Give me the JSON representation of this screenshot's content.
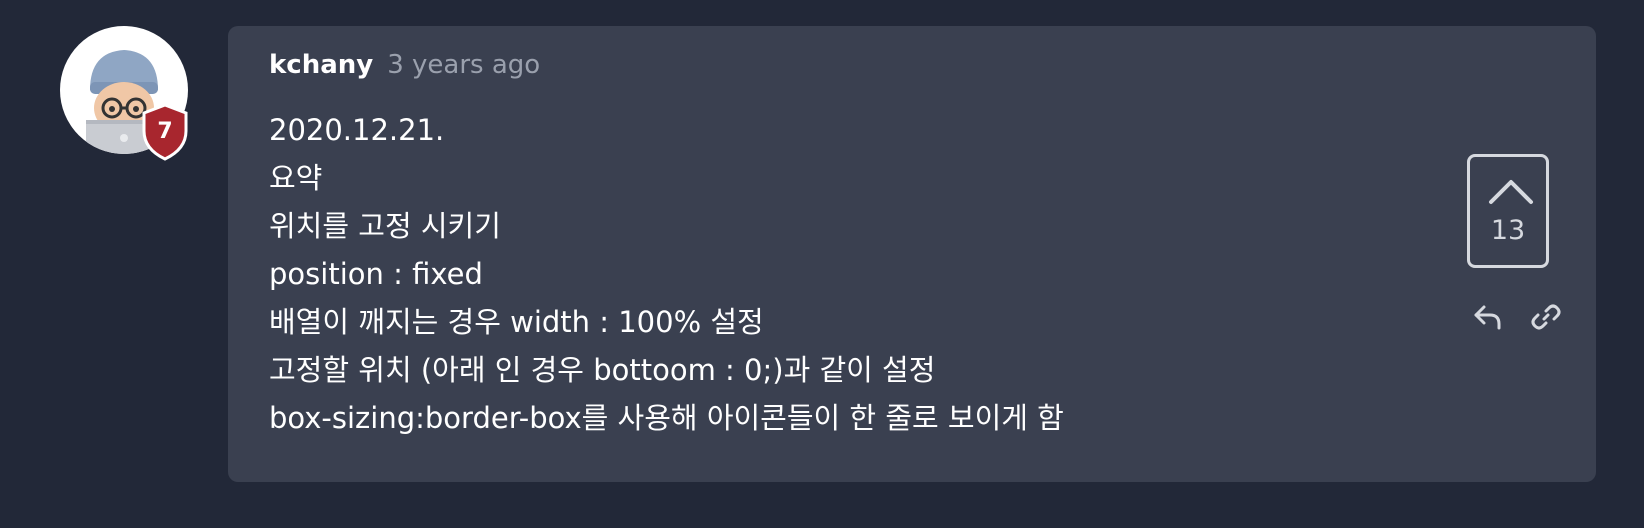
{
  "user": {
    "name": "kchany",
    "time_ago": "3 years ago",
    "badge_level": "7"
  },
  "comment": {
    "lines": [
      "2020.12.21.",
      "요약",
      "위치를 고정 시키기",
      "position : fixed",
      "배열이 깨지는 경우 width : 100% 설정",
      "고정할 위치 (아래 인 경우 bottoom : 0;)과 같이 설정",
      "box-sizing:border-box를 사용해 아이콘들이 한 줄로 보이게 함"
    ]
  },
  "vote": {
    "count": "13"
  },
  "icons": {
    "upvote": "chevron-up-icon",
    "reply": "reply-icon",
    "link": "link-icon",
    "avatar": "memoji-avatar",
    "badge": "shield-badge-icon"
  },
  "colors": {
    "page_bg": "#222838",
    "card_bg": "#3a4050",
    "text": "#ffffff",
    "muted": "#9aa0ad",
    "badge": "#a8262e"
  }
}
